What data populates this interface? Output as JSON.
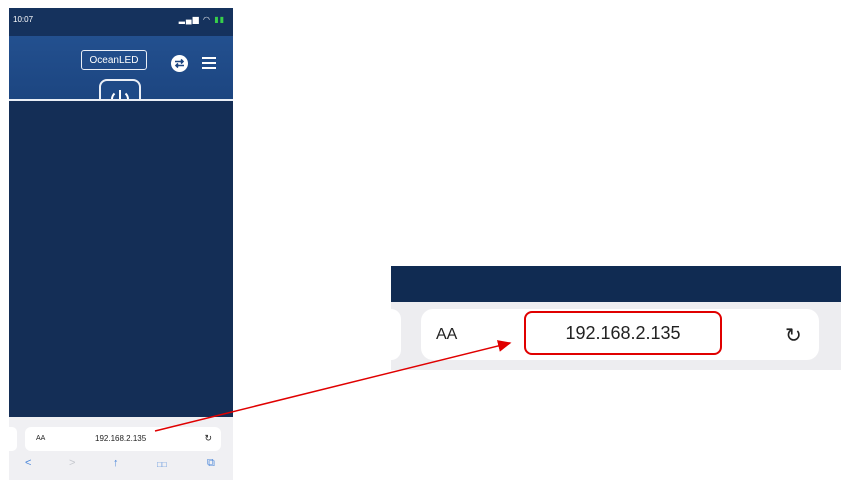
{
  "status_bar": {
    "time": "10:07",
    "signal_wifi": "▂▄▆ ◠",
    "battery": "▮▮"
  },
  "header": {
    "logo": "OceanLED",
    "power_icon": "power-icon",
    "sync_icon": "sync-icon",
    "menu_icon": "menu-icon"
  },
  "browser": {
    "aa_label": "AA",
    "url": "192.168.2.135",
    "reload_glyph": "↻",
    "nav": {
      "back": "<",
      "forward": ">",
      "share": "↑",
      "bookmarks": "□□",
      "tabs": "⧉"
    }
  },
  "zoom": {
    "aa_label": "AA",
    "url": "192.168.2.135",
    "reload_glyph": "↻"
  },
  "colors": {
    "header": "#23508f",
    "body": "#142e56",
    "highlight": "#e00000",
    "nav_blue": "#4a86d9"
  }
}
